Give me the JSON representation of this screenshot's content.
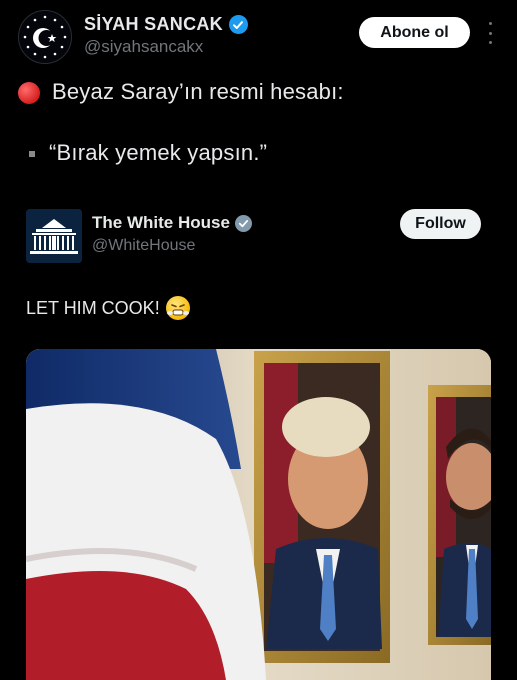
{
  "post": {
    "author_name": "SİYAH SANCAK",
    "author_handle": "@siyahsancakx",
    "follow_label": "Abone ol",
    "text_line1": "Beyaz Saray’ın resmi hesabı:",
    "text_line2": "“Bırak yemek yapsın.”"
  },
  "quoted_post": {
    "author_name": "The White House",
    "author_handle": "@WhiteHouse",
    "follow_label": "Follow",
    "text": "LET HIM COOK!"
  },
  "icons": {
    "avatar_outer": "crescent-star-avatar",
    "verified_outer": "verified-blue-badge",
    "more": "more-vertical-icon",
    "red_circle": "red-circle-emoji",
    "bullet": "square-bullet",
    "wh_avatar": "white-house-logo",
    "verified_quoted": "verified-gray-badge",
    "emoji": "steam-face-emoji"
  },
  "colors": {
    "background": "#000000",
    "text": "#e7e9ea",
    "muted": "#71767b",
    "verified_blue": "#1d9bf0",
    "gov_badge": "#829aab"
  }
}
